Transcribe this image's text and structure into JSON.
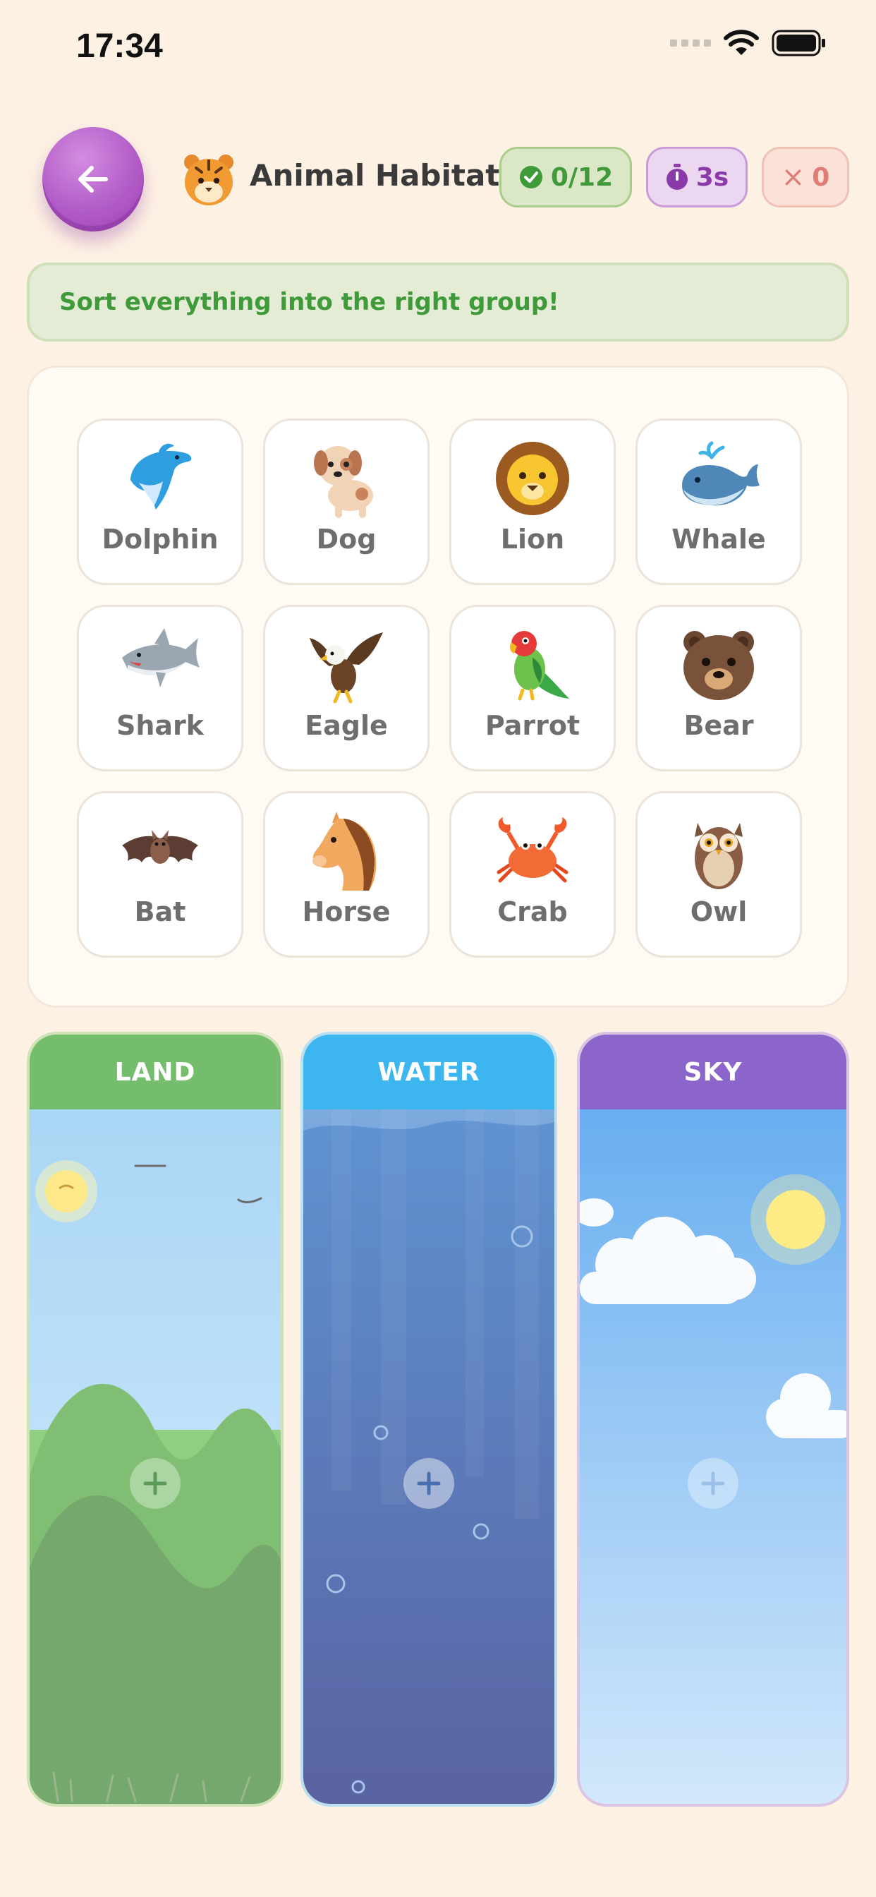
{
  "status_bar": {
    "time": "17:34"
  },
  "header": {
    "title": "Animal Habitat",
    "score": "0/12",
    "timer": "3s",
    "misses": "0",
    "miss_symbol": "×"
  },
  "instruction": "Sort everything into the right group!",
  "animals": [
    {
      "label": "Dolphin",
      "icon": "dolphin-icon"
    },
    {
      "label": "Dog",
      "icon": "dog-icon"
    },
    {
      "label": "Lion",
      "icon": "lion-icon"
    },
    {
      "label": "Whale",
      "icon": "whale-icon"
    },
    {
      "label": "Shark",
      "icon": "shark-icon"
    },
    {
      "label": "Eagle",
      "icon": "eagle-icon"
    },
    {
      "label": "Parrot",
      "icon": "parrot-icon"
    },
    {
      "label": "Bear",
      "icon": "bear-icon"
    },
    {
      "label": "Bat",
      "icon": "bat-icon"
    },
    {
      "label": "Horse",
      "icon": "horse-icon"
    },
    {
      "label": "Crab",
      "icon": "crab-icon"
    },
    {
      "label": "Owl",
      "icon": "owl-icon"
    }
  ],
  "zones": [
    {
      "label": "LAND",
      "color": "#74bd6d"
    },
    {
      "label": "WATER",
      "color": "#3db5ef"
    },
    {
      "label": "SKY",
      "color": "#8b65c9"
    }
  ],
  "colors": {
    "background": "#fdf1e3",
    "accent_purple": "#b25cc8",
    "success_green": "#3f9a39"
  }
}
